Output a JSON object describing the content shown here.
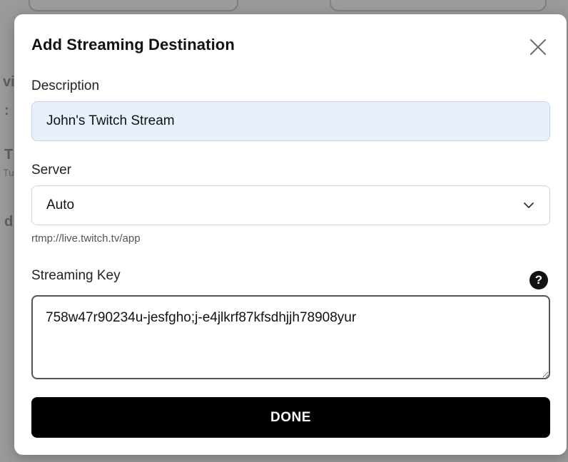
{
  "background": {
    "fragments": [
      "vi",
      ":",
      "T",
      "Tu",
      "d"
    ]
  },
  "modal": {
    "title": "Add Streaming Destination",
    "close_icon": "close-icon",
    "description": {
      "label": "Description",
      "value": "John's Twitch Stream"
    },
    "server": {
      "label": "Server",
      "selected": "Auto",
      "chevron_icon": "chevron-down-icon",
      "url": "rtmp://live.twitch.tv/app"
    },
    "streaming_key": {
      "label": "Streaming Key",
      "help_icon": "help-icon",
      "help_glyph": "?",
      "value": "758w47r90234u-jesfgho;j-e4jlkrf87kfsdhjjh78908yur"
    },
    "done_label": "DONE"
  },
  "colors": {
    "overlay": "#9a9a9a",
    "input_autofill": "#e8f0fe",
    "primary_button": "#000000"
  }
}
